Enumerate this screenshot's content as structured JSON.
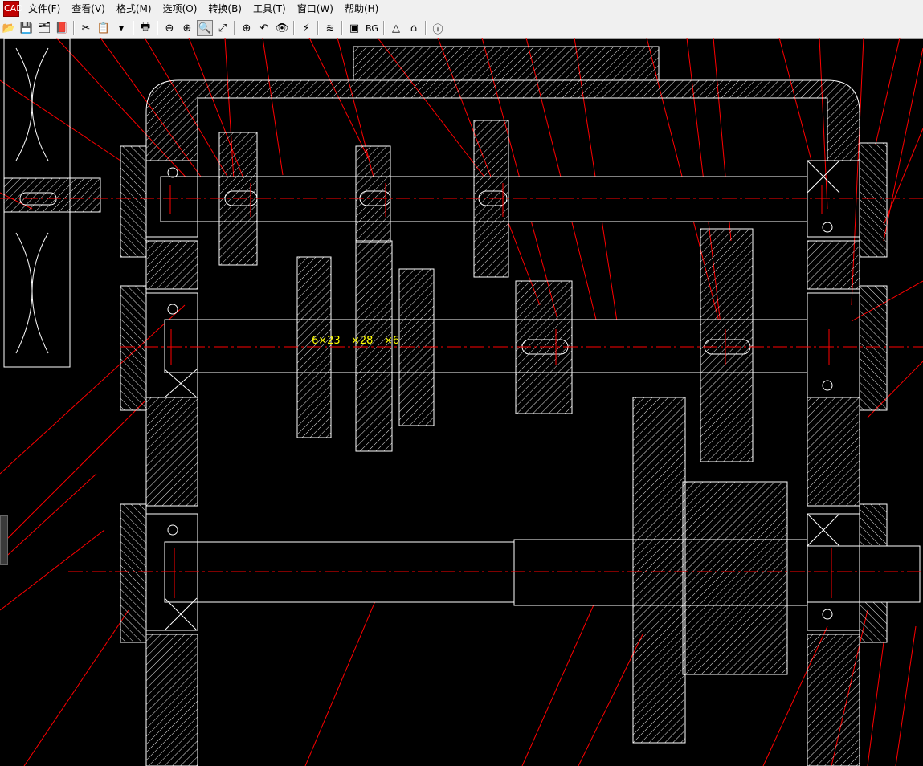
{
  "app": {
    "icon_label": "CAD"
  },
  "menu": [
    {
      "label": "文件(F)"
    },
    {
      "label": "查看(V)"
    },
    {
      "label": "格式(M)"
    },
    {
      "label": "选项(O)"
    },
    {
      "label": "转换(B)"
    },
    {
      "label": "工具(T)"
    },
    {
      "label": "窗口(W)"
    },
    {
      "label": "帮助(H)"
    }
  ],
  "toolbar": {
    "buttons": [
      {
        "name": "open-icon",
        "glyph": "📂"
      },
      {
        "name": "save-icon",
        "glyph": "💾"
      },
      {
        "name": "save-all-icon",
        "glyph": "🗂"
      },
      {
        "name": "export-icon",
        "glyph": "📕"
      },
      {
        "name": "sep"
      },
      {
        "name": "cut-icon",
        "glyph": "✂"
      },
      {
        "name": "copy-icon",
        "glyph": "📋"
      },
      {
        "name": "dropdown-icon",
        "glyph": "▾"
      },
      {
        "name": "sep"
      },
      {
        "name": "print-icon",
        "glyph": "🖶"
      },
      {
        "name": "sep"
      },
      {
        "name": "zoom-out-icon",
        "glyph": "⊖"
      },
      {
        "name": "zoom-in-icon",
        "glyph": "⊕"
      },
      {
        "name": "zoom-window-icon",
        "glyph": "🔍",
        "active": true
      },
      {
        "name": "zoom-realtime-icon",
        "glyph": "⤢"
      },
      {
        "name": "sep"
      },
      {
        "name": "zoom-all-icon",
        "glyph": "⊕"
      },
      {
        "name": "zoom-previous-icon",
        "glyph": "↶"
      },
      {
        "name": "view-icon",
        "glyph": "👁"
      },
      {
        "name": "sep"
      },
      {
        "name": "flash-icon",
        "glyph": "⚡"
      },
      {
        "name": "sep"
      },
      {
        "name": "layers-icon",
        "glyph": "≋"
      },
      {
        "name": "sep"
      },
      {
        "name": "frame-icon",
        "glyph": "▣"
      },
      {
        "name": "bg-button",
        "text": "BG"
      },
      {
        "name": "sep"
      },
      {
        "name": "measure-icon",
        "glyph": "△"
      },
      {
        "name": "home-icon",
        "glyph": "⌂"
      },
      {
        "name": "sep"
      },
      {
        "name": "info-icon",
        "glyph": "ⓘ"
      }
    ]
  },
  "drawing": {
    "spline_label": "6×23",
    "spline_label_mid": "×28",
    "spline_label_end": "×6",
    "colors": {
      "outline": "#ffffff",
      "leader": "#ff0000",
      "centerline": "#ff0000",
      "annotation": "#ffff00",
      "hatch": "#ffffff"
    }
  }
}
